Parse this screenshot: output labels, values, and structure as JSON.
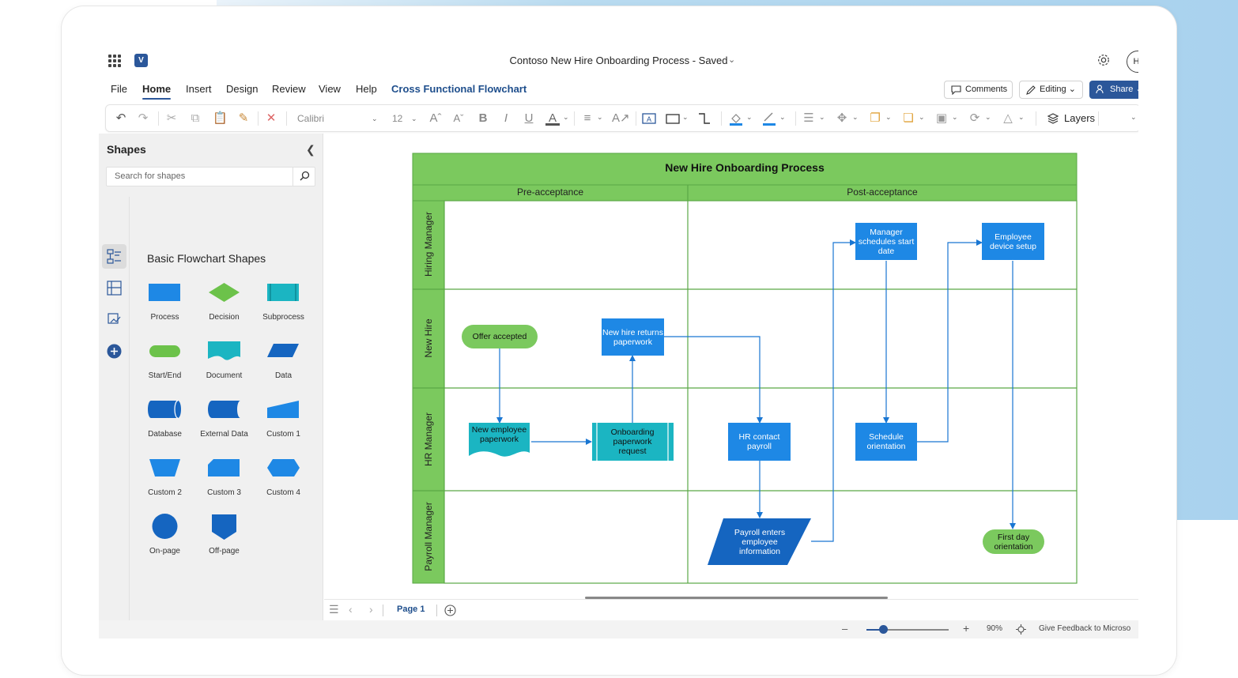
{
  "app": {
    "document_title": "Contoso New Hire Onboarding Process  -  Saved",
    "logo_letter": "V",
    "avatar_initials": "HI"
  },
  "menu": {
    "items": [
      "File",
      "Home",
      "Insert",
      "Design",
      "Review",
      "View",
      "Help",
      "Cross Functional Flowchart"
    ],
    "active": "Home"
  },
  "actions": {
    "comments": "Comments",
    "editing": "Editing",
    "share": "Share"
  },
  "toolbar": {
    "font": "Calibri",
    "size": "12",
    "layers": "Layers",
    "icons": [
      "undo-icon",
      "redo-icon",
      "cut-icon",
      "copy-icon",
      "paste-icon",
      "format-painter-icon",
      "delete-icon",
      "increase-font-icon",
      "decrease-font-icon",
      "bold-icon",
      "italic-icon",
      "underline-icon",
      "font-color-icon",
      "align-icon",
      "text-direction-icon",
      "text-box-icon",
      "rectangle-icon",
      "connector-icon",
      "fill-icon",
      "line-color-icon",
      "position-icon",
      "align-shapes-icon",
      "bring-forward-icon",
      "send-backward-icon",
      "group-icon",
      "rotate-icon",
      "flip-icon"
    ]
  },
  "shapes_panel": {
    "title": "Shapes",
    "search_placeholder": "Search for shapes",
    "stencil_title": "Basic Flowchart Shapes",
    "shapes": [
      "Process",
      "Decision",
      "Subprocess",
      "Start/End",
      "Document",
      "Data",
      "Database",
      "External Data",
      "Custom 1",
      "Custom 2",
      "Custom 3",
      "Custom 4",
      "On-page",
      "Off-page"
    ]
  },
  "diagram": {
    "title": "New Hire Onboarding Process",
    "phases": [
      "Pre-acceptance",
      "Post-acceptance"
    ],
    "lanes": [
      "Hiring Manager",
      "New Hire",
      "HR Manager",
      "Payroll Manager"
    ],
    "nodes": {
      "offer": "Offer accepted",
      "returns": "New hire returns paperwork",
      "new_paperwork": "New employee paperwork",
      "onboarding": "Onboarding paperwork request",
      "hr_payroll": "HR contact payroll",
      "schedules": "Manager schedules start date",
      "schedule_orient": "Schedule orientation",
      "device": "Employee device setup",
      "payroll_enters": "Payroll enters employee information",
      "first_day": "First day orientation"
    },
    "colors": {
      "header_green": "#7bc95e",
      "lane_line": "#5aa846",
      "process_blue": "#1e88e5",
      "teal": "#1bb5c2",
      "start_green": "#7bc95e",
      "connector": "#1976d2"
    }
  },
  "status": {
    "page_label": "Page 1",
    "zoom": "90%",
    "feedback": "Give Feedback to Microso"
  }
}
